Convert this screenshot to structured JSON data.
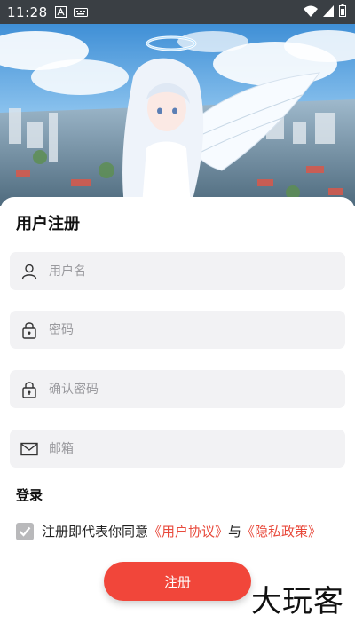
{
  "status_bar": {
    "time": "11:28",
    "icons": [
      "font-icon",
      "keyboard-icon",
      "wifi-icon",
      "signal-icon",
      "battery-icon"
    ]
  },
  "hero": {
    "icons": [
      "anime-angel-illustration"
    ]
  },
  "form": {
    "title": "用户注册",
    "username_placeholder": "用户名",
    "password_placeholder": "密码",
    "confirm_placeholder": "确认密码",
    "email_placeholder": "邮箱",
    "login_link": "登录",
    "agree_prefix": "注册即代表你同意",
    "user_agreement": "《用户协议》",
    "conjunction": "与",
    "privacy_policy": "《隐私政策》",
    "agree_checked": true,
    "register_label": "注册"
  },
  "watermark": {
    "text": "大玩客"
  },
  "colors": {
    "accent": "#f1463a",
    "link": "#e84a3c",
    "field_bg": "#f2f2f4",
    "status_bar": "#3a3f44"
  }
}
